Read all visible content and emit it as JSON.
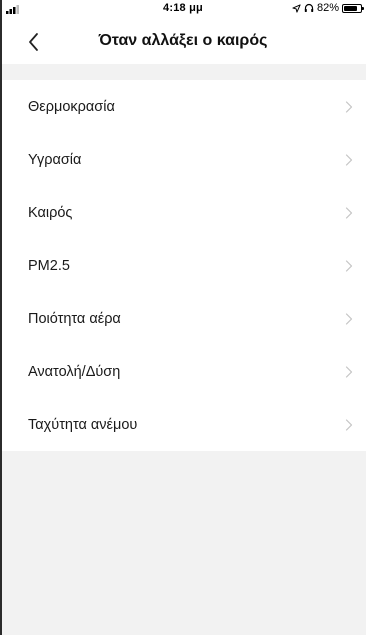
{
  "status_bar": {
    "time": "4:18 μμ",
    "battery_text": "82%",
    "battery_level": 0.82,
    "icons": [
      "signal-icon",
      "location-icon",
      "headphones-icon",
      "battery-icon"
    ]
  },
  "nav": {
    "title": "Όταν αλλάξει ο καιρός",
    "back_icon": "chevron-left-icon"
  },
  "list": {
    "items": [
      {
        "label": "Θερμοκρασία"
      },
      {
        "label": "Υγρασία"
      },
      {
        "label": "Καιρός"
      },
      {
        "label": "PM2.5"
      },
      {
        "label": "Ποιότητα αέρα"
      },
      {
        "label": "Ανατολή/Δύση"
      },
      {
        "label": "Ταχύτητα ανέμου"
      }
    ],
    "chevron_icon": "chevron-right-icon"
  }
}
